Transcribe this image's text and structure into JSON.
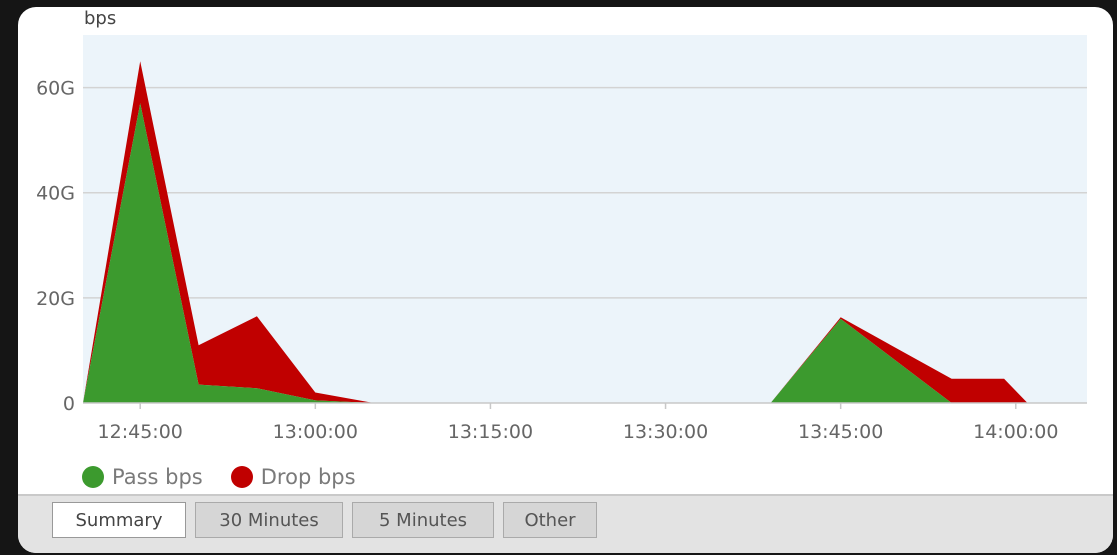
{
  "legend": {
    "pass": "Pass bps",
    "drop": "Drop bps"
  },
  "tabs": [
    {
      "label": "Summary",
      "active": true
    },
    {
      "label": "30 Minutes",
      "active": false
    },
    {
      "label": "5 Minutes",
      "active": false
    },
    {
      "label": "Other",
      "active": false
    }
  ],
  "colors": {
    "pass": "#3c9a2e",
    "drop": "#c00000",
    "plot_bg": "#ecf4fa",
    "grid": "#d3d3d3",
    "axis_text": "#666666"
  },
  "chart_data": {
    "type": "area",
    "stacked": true,
    "ylabel": "bps",
    "xlabel": "",
    "y_ticks": [
      {
        "value": 0,
        "label": "0"
      },
      {
        "value": 20,
        "label": "20G"
      },
      {
        "value": 40,
        "label": "40G"
      },
      {
        "value": 60,
        "label": "60G"
      }
    ],
    "ylim": [
      0,
      70
    ],
    "x_ticks": [
      {
        "value": 765,
        "label": "12:45:00"
      },
      {
        "value": 780,
        "label": "13:00:00"
      },
      {
        "value": 795,
        "label": "13:15:00"
      },
      {
        "value": 810,
        "label": "13:30:00"
      },
      {
        "value": 825,
        "label": "13:45:00"
      },
      {
        "value": 840,
        "label": "14:00:00"
      }
    ],
    "xlim": [
      760.1,
      846.1
    ],
    "grid": true,
    "legend_position": "bottom-left",
    "series": [
      {
        "name": "Pass bps",
        "color": "#3c9a2e",
        "points": [
          [
            760.1,
            0
          ],
          [
            765,
            57
          ],
          [
            770,
            3.5
          ],
          [
            775,
            2.8
          ],
          [
            780,
            0.5
          ],
          [
            785,
            0
          ],
          [
            790,
            0
          ],
          [
            795,
            0
          ],
          [
            800,
            0
          ],
          [
            805,
            0
          ],
          [
            810,
            0
          ],
          [
            815,
            0
          ],
          [
            819,
            0
          ],
          [
            825,
            16
          ],
          [
            834.5,
            0
          ],
          [
            839,
            0
          ],
          [
            841,
            0
          ]
        ]
      },
      {
        "name": "Drop bps",
        "color": "#c00000",
        "points": [
          [
            760.1,
            0
          ],
          [
            765,
            8
          ],
          [
            770,
            7.5
          ],
          [
            775,
            13.7
          ],
          [
            780,
            1.5
          ],
          [
            785,
            0
          ],
          [
            790,
            0
          ],
          [
            795,
            0
          ],
          [
            800,
            0
          ],
          [
            805,
            0
          ],
          [
            810,
            0
          ],
          [
            815,
            0
          ],
          [
            819,
            0
          ],
          [
            825,
            0.3
          ],
          [
            834.5,
            4.6
          ],
          [
            839,
            4.6
          ],
          [
            841,
            0
          ]
        ]
      }
    ]
  }
}
